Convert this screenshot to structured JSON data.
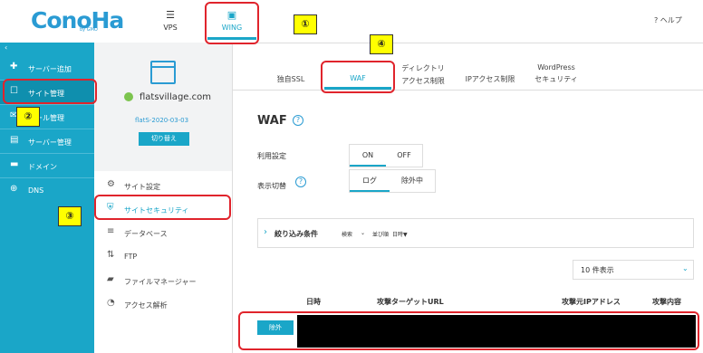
{
  "header": {
    "logo": "ConoHa",
    "logo_sub": "by GMO",
    "nav": [
      {
        "label": "VPS",
        "icon": "server-icon"
      },
      {
        "label": "WING",
        "icon": "wing-icon"
      }
    ],
    "help_label": "ヘルプ"
  },
  "sidebar": {
    "toggle": "‹",
    "items": [
      {
        "label": "サーバー追加",
        "icon": "plus-icon"
      },
      {
        "label": "サイト管理",
        "icon": "site-icon"
      },
      {
        "label": "メール管理",
        "icon": "mail-icon"
      },
      {
        "label": "サーバー管理",
        "icon": "server-manage-icon"
      },
      {
        "label": "ドメイン",
        "icon": "domain-icon"
      },
      {
        "label": "DNS",
        "icon": "globe-icon"
      }
    ]
  },
  "site": {
    "domain": "flatsvillage.com",
    "id": "flatS-2020-03-03",
    "switch_label": "切り替え"
  },
  "site_menu": [
    {
      "label": "サイト設定",
      "icon": "site-settings-icon"
    },
    {
      "label": "サイトセキュリティ",
      "icon": "shield-icon"
    },
    {
      "label": "データベース",
      "icon": "database-icon"
    },
    {
      "label": "FTP",
      "icon": "ftp-icon"
    },
    {
      "label": "ファイルマネージャー",
      "icon": "folder-icon"
    },
    {
      "label": "アクセス解析",
      "icon": "pie-chart-icon"
    }
  ],
  "tabs": [
    {
      "label": "独自SSL"
    },
    {
      "label": "WAF"
    },
    {
      "label1": "ディレクトリ",
      "label2": "アクセス制限"
    },
    {
      "label": "IPアクセス制限"
    },
    {
      "label1": "WordPress",
      "label2": "セキュリティ"
    }
  ],
  "waf": {
    "title": "WAF",
    "help_icon": "?",
    "usage_label": "利用設定",
    "usage_on": "ON",
    "usage_off": "OFF",
    "display_label": "表示切替",
    "display_log": "ログ",
    "display_excl": "除外中",
    "filter_title": "絞り込み条件",
    "filter_search": "検索",
    "filter_sort": "並び順",
    "filter_sort_value": "日時▼",
    "per_page": "10 件表示",
    "columns": [
      "日時",
      "攻撃ターゲットURL",
      "攻撃元IPアドレス",
      "攻撃内容"
    ],
    "row_button": "除外"
  },
  "annotations": [
    "①",
    "②",
    "③",
    "④"
  ],
  "colors": {
    "accent": "#1aa6c8",
    "annotation": "#e0242c",
    "marker": "#ffff00"
  }
}
